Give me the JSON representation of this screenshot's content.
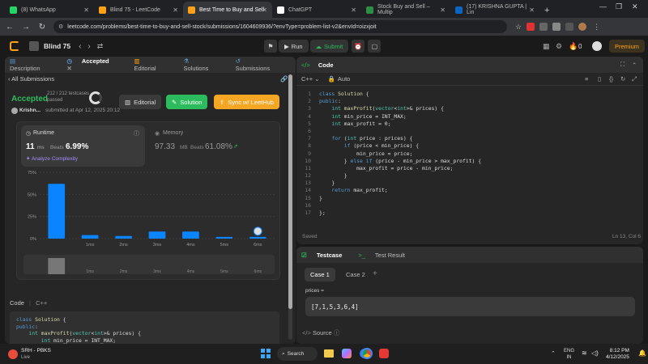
{
  "browser": {
    "tabs": [
      {
        "label": "(8) WhatsApp",
        "color": "#25d366"
      },
      {
        "label": "Blind 75 - LeetCode",
        "color": "#ffa116"
      },
      {
        "label": "Best Time to Buy and Sell",
        "color": "#ffa116"
      },
      {
        "label": "ChatGPT",
        "color": "#ffffff"
      },
      {
        "label": "Stock Buy and Sell – Multip",
        "color": "#2f8d46"
      },
      {
        "label": "(17) KRISHNA GUPTA | Lin",
        "color": "#0a66c2"
      }
    ],
    "url": "leetcode.com/problems/best-time-to-buy-and-sell-stock/submissions/1604609936/?envType=problem-list-v2&envId=oizxjoit"
  },
  "lc_header": {
    "list_title": "Blind 75",
    "run": "Run",
    "submit": "Submit",
    "fire_count": "0",
    "premium": "Premium"
  },
  "left": {
    "tabs": [
      "Description",
      "Accepted",
      "Editorial",
      "Solutions",
      "Submissions"
    ],
    "back": "All Submissions",
    "status": "Accepted",
    "tests": "212 / 212 testcases passed",
    "user": "Krishn...",
    "submitted": "submitted at Apr 12, 2025 20:12",
    "editorial_btn": "Editorial",
    "solution_btn": "Solution",
    "sync_btn": "Sync w/ LeetHub",
    "runtime_label": "Runtime",
    "runtime_val": "11",
    "runtime_unit": "ms",
    "beats_label": "Beats",
    "runtime_beats": "6.99%",
    "analyze": "Analyze Complexity",
    "memory_label": "Memory",
    "memory_val": "97.33",
    "memory_unit": "MB",
    "memory_beats": "61.08%",
    "code_label": "Code",
    "lang": "C++",
    "code_snippet": [
      "class Solution {",
      "public:",
      "    int maxProfit(vector<int>& prices) {",
      "        int min_price = INT_MAX;",
      "        int max_profit = 0;"
    ]
  },
  "chart_data": {
    "type": "bar",
    "categories": [
      "",
      "1ms",
      "2ms",
      "3ms",
      "4ms",
      "5ms",
      "6ms"
    ],
    "values": [
      62,
      4,
      3,
      8,
      8,
      2,
      2
    ],
    "yticks": [
      "75%",
      "50%",
      "25%",
      "0%"
    ],
    "ylim": [
      0,
      75
    ],
    "bar_color": "#0a84ff"
  },
  "editor": {
    "title": "Code",
    "lang": "C++",
    "mode": "Auto",
    "saved": "Saved",
    "cursor": "Ln 13, Col 6",
    "lines": [
      "class Solution {",
      "public:",
      "    int maxProfit(vector<int>& prices) {",
      "    int min_price = INT_MAX;",
      "    int max_profit = 0;",
      "",
      "    for (int price : prices) {",
      "        if (price < min_price) {",
      "            min_price = price;",
      "        } else if (price - min_price > max_profit) {",
      "            max_profit = price - min_price;",
      "        }",
      "    }",
      "    return max_profit;",
      "}",
      "",
      "};"
    ]
  },
  "testcase": {
    "tab1": "Testcase",
    "tab2": "Test Result",
    "cases": [
      "Case 1",
      "Case 2"
    ],
    "var_label": "prices =",
    "value": "[7,1,5,3,6,4]",
    "source": "Source"
  },
  "taskbar": {
    "news_title": "SRH - PBKS",
    "news_sub": "Live",
    "search": "Search",
    "lang1": "ENG",
    "lang2": "IN",
    "time": "8:12 PM",
    "date": "4/12/2025"
  }
}
